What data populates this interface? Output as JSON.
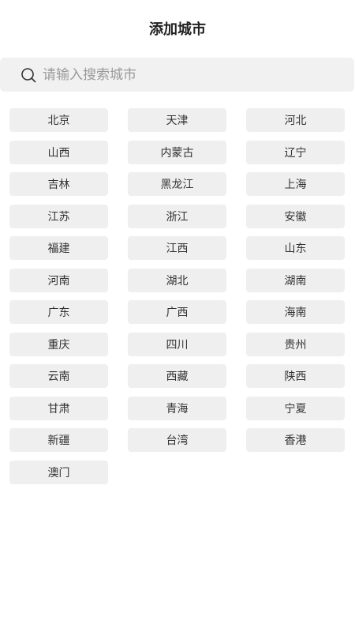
{
  "header": {
    "title": "添加城市"
  },
  "search": {
    "placeholder": "请输入搜索城市",
    "value": ""
  },
  "cities": [
    "北京",
    "天津",
    "河北",
    "山西",
    "内蒙古",
    "辽宁",
    "吉林",
    "黑龙江",
    "上海",
    "江苏",
    "浙江",
    "安徽",
    "福建",
    "江西",
    "山东",
    "河南",
    "湖北",
    "湖南",
    "广东",
    "广西",
    "海南",
    "重庆",
    "四川",
    "贵州",
    "云南",
    "西藏",
    "陕西",
    "甘肃",
    "青海",
    "宁夏",
    "新疆",
    "台湾",
    "香港",
    "澳门"
  ]
}
